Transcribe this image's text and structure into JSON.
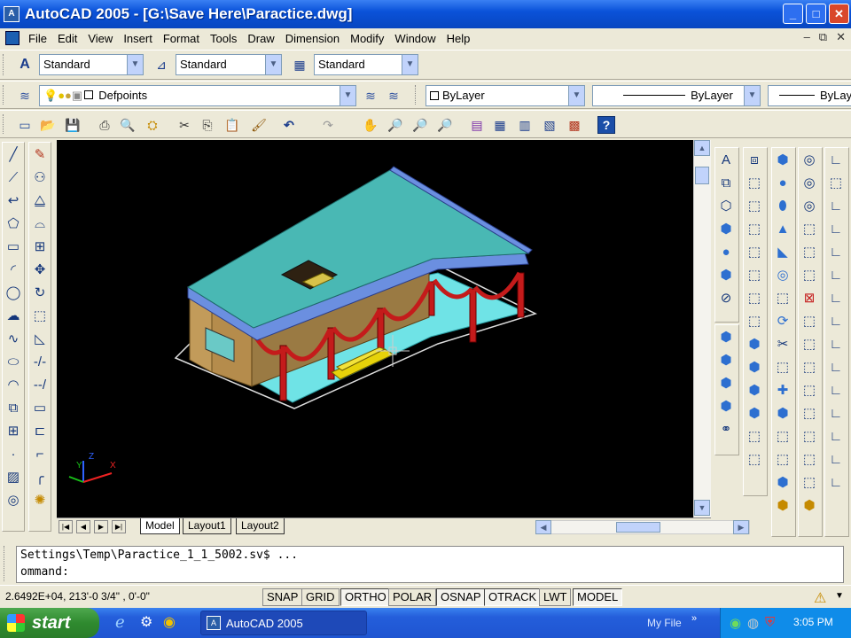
{
  "window": {
    "app_icon": "autocad-app-icon",
    "title": "AutoCAD 2005 - [G:\\Save Here\\Paractice.dwg]",
    "minimize": "minimize-icon",
    "maximize": "maximize-icon",
    "close": "close-icon"
  },
  "menu": [
    "File",
    "Edit",
    "View",
    "Insert",
    "Format",
    "Tools",
    "Draw",
    "Dimension",
    "Modify",
    "Window",
    "Help"
  ],
  "styles_toolbar": {
    "text_style": "Standard",
    "dim_style": "Standard",
    "table_style": "Standard"
  },
  "layers_toolbar": {
    "layer": "Defpoints",
    "color": "ByLayer",
    "linetype": "ByLayer",
    "lineweight": "ByLay"
  },
  "tabs": {
    "model": "Model",
    "layout1": "Layout1",
    "layout2": "Layout2"
  },
  "command_line": {
    "history": "Settings\\Temp\\Paractice_1_1_5002.sv$ ...",
    "prompt": "ommand:"
  },
  "status": {
    "coords": "2.6492E+04,  213'-0 3/4\" , 0'-0\"",
    "buttons": [
      "SNAP",
      "GRID",
      "ORTHO",
      "POLAR",
      "OSNAP",
      "OTRACK",
      "LWT",
      "MODEL"
    ]
  },
  "ucs": {
    "x": "X",
    "y": "Y",
    "z": "Z"
  },
  "taskbar": {
    "start": "start",
    "task": "AutoCAD 2005",
    "tray_label": "My File",
    "time": "3:05 PM"
  },
  "colors": {
    "roof": "#49b8b4",
    "roof_trim": "#6b8fe0",
    "walls": "#c29b5a",
    "posts": "#c41b1b",
    "floor": "#6fe3e6",
    "xp_blue": "#245edb"
  }
}
